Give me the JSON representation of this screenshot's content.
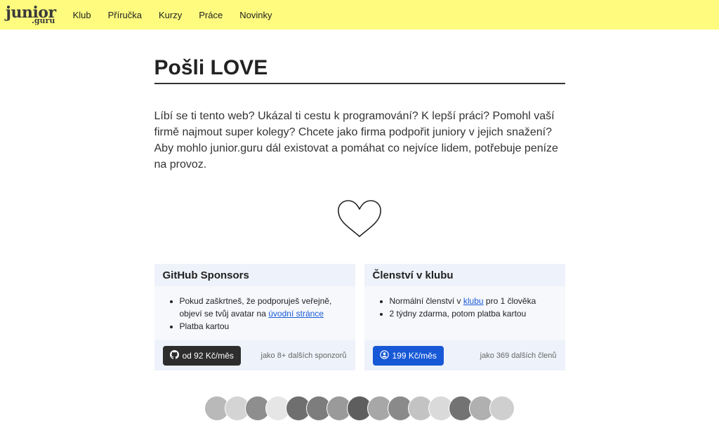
{
  "logo": {
    "main": "junior",
    "sub": ".guru"
  },
  "nav": [
    "Klub",
    "Příručka",
    "Kurzy",
    "Práce",
    "Novinky"
  ],
  "title": "Pošli LOVE",
  "lead": "Líbí se ti tento web? Ukázal ti cestu k programování? K lepší práci? Pomohl vaší firmě najmout super kolegy? Chcete jako firma podpořit juniory v jejich snažení? Aby mohlo junior.guru dál existovat a pomáhat co nejvíce lidem, potřebuje peníze na provoz.",
  "cards": [
    {
      "title": "GitHub Sponsors",
      "item1_text": "Pokud zaškrtneš, že podporuješ veřejně, objeví se tvůj avatar na ",
      "item1_link": "úvodní stránce",
      "item2": "Platba kartou",
      "button": "od 92 Kč/měs",
      "button_icon": "github-icon",
      "note": "jako 8+ dalších sponzorů"
    },
    {
      "title": "Členství v klubu",
      "item1_text": "Normální členství v ",
      "item1_link": "klubu",
      "item1_rest": " pro 1 člověka",
      "item2": "2 týdny zdarma, potom platba kartou",
      "button": "199 Kč/měs",
      "button_icon": "user-circle-icon",
      "note": "jako 369 dalších členů"
    }
  ],
  "colors": {
    "topbar": "#fefb7e",
    "link": "#1a5bd6",
    "button_dark": "#2d2d2d",
    "button_blue": "#1758d6"
  },
  "avatars": {
    "count": 15,
    "shades": [
      "#b9b9b9",
      "#d4d4d4",
      "#8e8e8e",
      "#e6e6e6",
      "#6f6f6f",
      "#7d7d7d",
      "#9a9a9a",
      "#5e5e5e",
      "#a7a7a7",
      "#8a8a8a",
      "#c3c3c3",
      "#dadada",
      "#737373",
      "#b0b0b0",
      "#cfcfcf"
    ]
  }
}
